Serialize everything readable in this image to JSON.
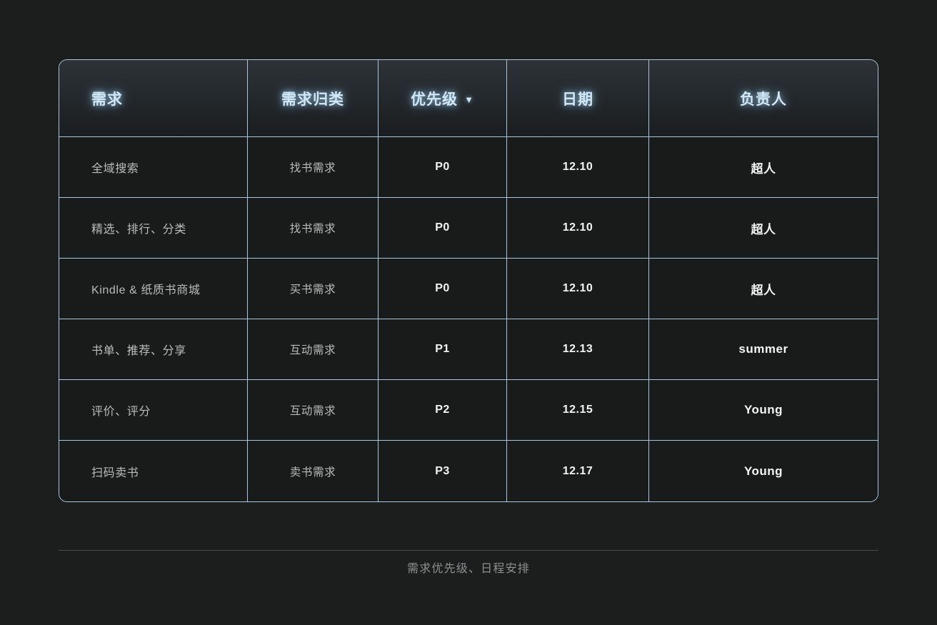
{
  "table": {
    "columns": [
      {
        "key": "requirement",
        "label": "需求",
        "align": "left",
        "sortable": false
      },
      {
        "key": "category",
        "label": "需求归类",
        "align": "center",
        "sortable": false
      },
      {
        "key": "priority",
        "label": "优先级",
        "align": "center",
        "sortable": true,
        "sort_icon": "caret-down-icon",
        "sort_glyph": "▼"
      },
      {
        "key": "date",
        "label": "日期",
        "align": "center",
        "sortable": false
      },
      {
        "key": "owner",
        "label": "负责人",
        "align": "center",
        "sortable": false
      }
    ],
    "rows": [
      {
        "requirement": "全域搜索",
        "category": "找书需求",
        "priority": "P0",
        "date": "12.10",
        "owner": "超人"
      },
      {
        "requirement": "精选、排行、分类",
        "category": "找书需求",
        "priority": "P0",
        "date": "12.10",
        "owner": "超人"
      },
      {
        "requirement": "Kindle & 纸质书商城",
        "category": "买书需求",
        "priority": "P0",
        "date": "12.10",
        "owner": "超人"
      },
      {
        "requirement": "书单、推荐、分享",
        "category": "互动需求",
        "priority": "P1",
        "date": "12.13",
        "owner": "summer"
      },
      {
        "requirement": "评价、评分",
        "category": "互动需求",
        "priority": "P2",
        "date": "12.15",
        "owner": "Young"
      },
      {
        "requirement": "扫码卖书",
        "category": "卖书需求",
        "priority": "P3",
        "date": "12.17",
        "owner": "Young"
      }
    ]
  },
  "footer": {
    "caption": "需求优先级、日程安排"
  },
  "colors": {
    "background": "#1c1e1e",
    "table_border": "#a8c6e2",
    "header_text": "#d2e8f8",
    "cell_fill": "#191b1a",
    "body_text_primary": "#f2f4f4",
    "body_text_secondary": "#b9bdbd",
    "footer_rule": "#4a4d4d",
    "footer_text": "#8d9191"
  }
}
